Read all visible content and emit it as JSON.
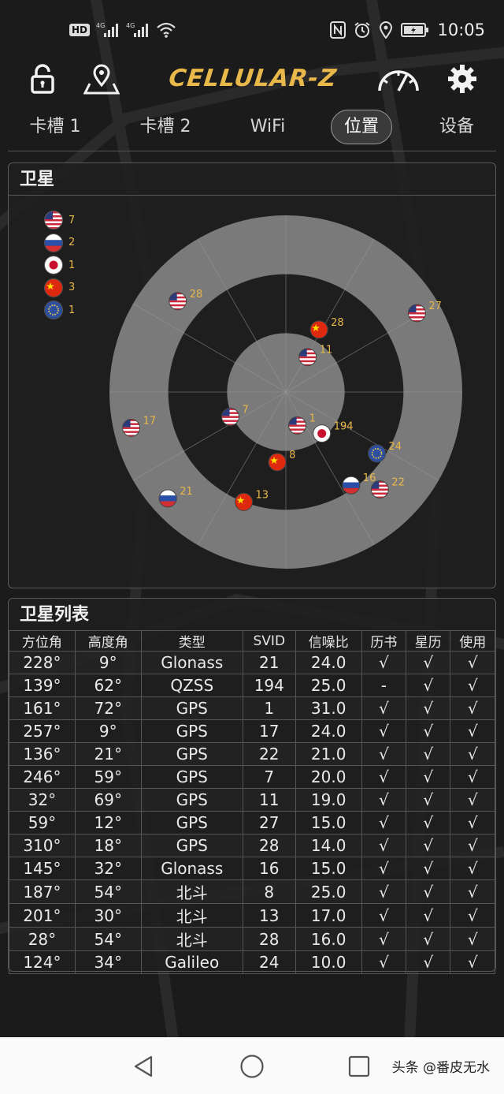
{
  "status_bar": {
    "left_icons": [
      "hd-badge",
      "signal-4g-icon",
      "signal-4g-icon",
      "wifi-icon"
    ],
    "hd_label": "HD",
    "right_icons": [
      "nfc-icon",
      "alarm-icon",
      "location-icon",
      "battery-icon"
    ],
    "time": "10:05"
  },
  "header": {
    "logo_text": "CELLULAR-Z",
    "left_icons": [
      "lock-icon",
      "map-pin-icon"
    ],
    "right_icons": [
      "speedometer-icon",
      "gear-icon"
    ]
  },
  "tabs": [
    {
      "label": "卡槽 1",
      "active": false
    },
    {
      "label": "卡槽 2",
      "active": false
    },
    {
      "label": "WiFi",
      "active": false
    },
    {
      "label": "位置",
      "active": true
    },
    {
      "label": "设备",
      "active": false
    }
  ],
  "satellites_panel": {
    "title": "卫星",
    "legend": [
      {
        "flag": "us",
        "count": "7"
      },
      {
        "flag": "ru",
        "count": "2"
      },
      {
        "flag": "jp",
        "count": "1"
      },
      {
        "flag": "cn",
        "count": "3"
      },
      {
        "flag": "eu",
        "count": "1"
      }
    ],
    "sky_plot": [
      {
        "flag": "ru",
        "svid": "21",
        "azimuth": 228,
        "elevation": 9
      },
      {
        "flag": "jp",
        "svid": "194",
        "azimuth": 139,
        "elevation": 62
      },
      {
        "flag": "us",
        "svid": "1",
        "azimuth": 161,
        "elevation": 72
      },
      {
        "flag": "us",
        "svid": "17",
        "azimuth": 257,
        "elevation": 9
      },
      {
        "flag": "us",
        "svid": "22",
        "azimuth": 136,
        "elevation": 21
      },
      {
        "flag": "us",
        "svid": "7",
        "azimuth": 246,
        "elevation": 59
      },
      {
        "flag": "us",
        "svid": "11",
        "azimuth": 32,
        "elevation": 69
      },
      {
        "flag": "us",
        "svid": "27",
        "azimuth": 59,
        "elevation": 12
      },
      {
        "flag": "us",
        "svid": "28",
        "azimuth": 310,
        "elevation": 18
      },
      {
        "flag": "ru",
        "svid": "16",
        "azimuth": 145,
        "elevation": 32
      },
      {
        "flag": "cn",
        "svid": "8",
        "azimuth": 187,
        "elevation": 54
      },
      {
        "flag": "cn",
        "svid": "13",
        "azimuth": 201,
        "elevation": 30
      },
      {
        "flag": "cn",
        "svid": "28",
        "azimuth": 28,
        "elevation": 54
      },
      {
        "flag": "eu",
        "svid": "24",
        "azimuth": 124,
        "elevation": 34
      }
    ]
  },
  "list_panel": {
    "title": "卫星列表",
    "columns": [
      "方位角",
      "高度角",
      "类型",
      "SVID",
      "信噪比",
      "历书",
      "星历",
      "使用"
    ],
    "rows": [
      [
        "228°",
        "9°",
        "Glonass",
        "21",
        "24.0",
        "√",
        "√",
        "√"
      ],
      [
        "139°",
        "62°",
        "QZSS",
        "194",
        "25.0",
        "-",
        "√",
        "√"
      ],
      [
        "161°",
        "72°",
        "GPS",
        "1",
        "31.0",
        "√",
        "√",
        "√"
      ],
      [
        "257°",
        "9°",
        "GPS",
        "17",
        "24.0",
        "√",
        "√",
        "√"
      ],
      [
        "136°",
        "21°",
        "GPS",
        "22",
        "21.0",
        "√",
        "√",
        "√"
      ],
      [
        "246°",
        "59°",
        "GPS",
        "7",
        "20.0",
        "√",
        "√",
        "√"
      ],
      [
        "32°",
        "69°",
        "GPS",
        "11",
        "19.0",
        "√",
        "√",
        "√"
      ],
      [
        "59°",
        "12°",
        "GPS",
        "27",
        "15.0",
        "√",
        "√",
        "√"
      ],
      [
        "310°",
        "18°",
        "GPS",
        "28",
        "14.0",
        "√",
        "√",
        "√"
      ],
      [
        "145°",
        "32°",
        "Glonass",
        "16",
        "15.0",
        "√",
        "√",
        "√"
      ],
      [
        "187°",
        "54°",
        "北斗",
        "8",
        "25.0",
        "√",
        "√",
        "√"
      ],
      [
        "201°",
        "30°",
        "北斗",
        "13",
        "17.0",
        "√",
        "√",
        "√"
      ],
      [
        "28°",
        "54°",
        "北斗",
        "28",
        "16.0",
        "√",
        "√",
        "√"
      ],
      [
        "124°",
        "34°",
        "Galileo",
        "24",
        "10.0",
        "√",
        "√",
        "√"
      ]
    ]
  },
  "nav_bar": {
    "buttons": [
      "back-icon",
      "home-icon",
      "recents-icon"
    ],
    "watermark": "头条 @番皮无水"
  },
  "colors": {
    "accent": "#e8b84a",
    "background": "#1b1b1b",
    "panel_border": "#5a5a5a",
    "ring_light": "#7a7a7a",
    "ring_dark": "#1e1e1e"
  }
}
